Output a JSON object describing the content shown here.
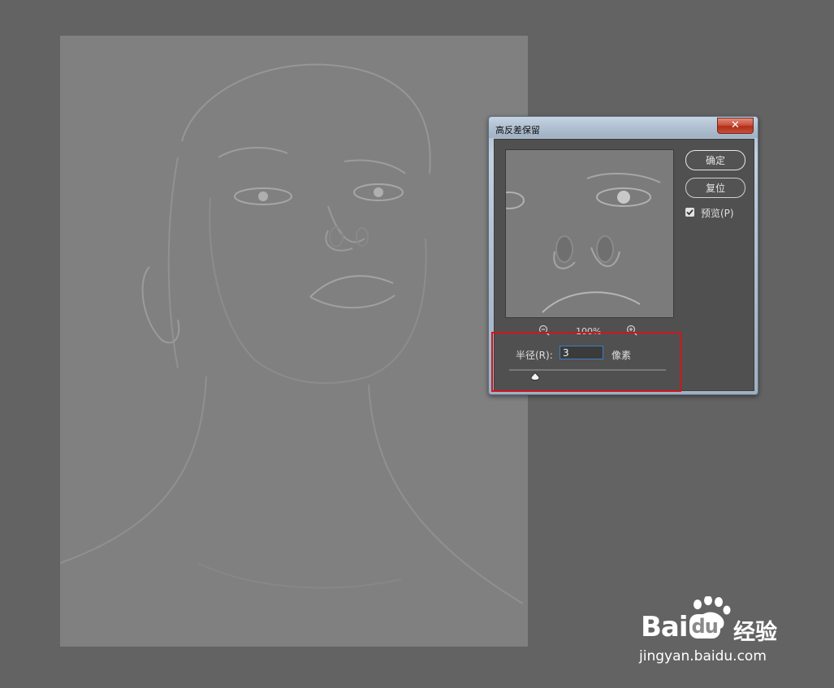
{
  "dialog": {
    "title": "高反差保留",
    "close_label": "✕",
    "ok_label": "确定",
    "reset_label": "复位",
    "preview_label": "预览(P)",
    "preview_checked": true,
    "zoom_level": "100%",
    "radius_label": "半径(R):",
    "radius_value": "3",
    "unit_label": "像素"
  },
  "icons": [
    "zoom-out-icon",
    "zoom-in-icon",
    "checkmark-icon",
    "slider-thumb-icon",
    "close-icon"
  ],
  "colors": {
    "workspace": "#636363",
    "canvas": "#808080",
    "dialog_body": "#505050",
    "highlight": "#d2141c",
    "focus": "#3f7bc6"
  },
  "watermark": {
    "brand": "Bai",
    "brand_suffix": "du",
    "product": "经验",
    "url": "jingyan.baidu.com"
  }
}
